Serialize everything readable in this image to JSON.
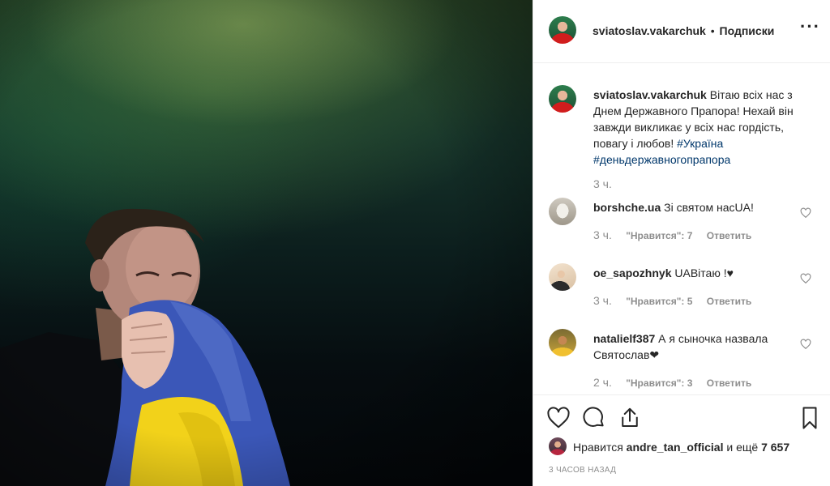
{
  "post": {
    "image_description_icon": "photo-man-with-ukrainian-flag",
    "author": {
      "username": "sviatoslav.vakarchuk",
      "separator": "•",
      "follow_label": "Подписки",
      "more_icon": "more-options-icon"
    },
    "caption": {
      "username": "sviatoslav.vakarchuk",
      "text": "Вітаю всіх нас з Днем Державного Прапора! Нехай він завжди викликає у всіх нас гордість, повагу і любов!",
      "hashtag1": "#Україна",
      "hashtag2": "#деньдержавногопрапора",
      "time": "3 ч."
    },
    "comments": [
      {
        "username": "borshche.ua",
        "text": "Зі святом насUA!",
        "time": "3 ч.",
        "likes": "\"Нравится\": 7",
        "reply": "Ответить"
      },
      {
        "username": "oe_sapozhnyk",
        "text": "UAВітаю !♥",
        "time": "3 ч.",
        "likes": "\"Нравится\": 5",
        "reply": "Ответить"
      },
      {
        "username": "natalielf387",
        "text": "А я сыночка назвала Святослав❤",
        "time": "2 ч.",
        "likes": "\"Нравится\": 3",
        "reply": "Ответить"
      }
    ],
    "likes": {
      "prefix": "Нравится",
      "user": "andre_tan_official",
      "middle": "и ещё",
      "count": "7 657"
    },
    "timestamp": "3 ЧАСОВ НАЗАД",
    "colors": {
      "text": "#262626",
      "muted": "#8e8e8e",
      "hashtag": "#00376b",
      "border": "#efefef",
      "flag_blue": "#3b57b8",
      "flag_yellow": "#f2d21a"
    }
  }
}
